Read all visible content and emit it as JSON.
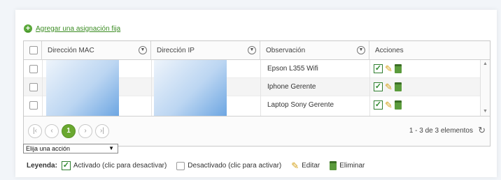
{
  "add_link": {
    "label": "Agregar una asignación fija",
    "icon": "plus-circle-icon"
  },
  "grid": {
    "columns": [
      {
        "key": "select",
        "label": ""
      },
      {
        "key": "mac",
        "label": "Dirección MAC"
      },
      {
        "key": "ip",
        "label": "Dirección IP"
      },
      {
        "key": "obs",
        "label": "Observación"
      },
      {
        "key": "actions",
        "label": "Acciones"
      }
    ],
    "rows": [
      {
        "mac": "",
        "ip": "",
        "obs": "Epson L355 Wifi",
        "actions": [
          "toggle-check-icon",
          "edit-pencil-icon",
          "delete-trash-icon"
        ]
      },
      {
        "mac": "",
        "ip": "",
        "obs": "Iphone Gerente",
        "actions": [
          "toggle-check-icon",
          "edit-pencil-icon",
          "delete-trash-icon"
        ]
      },
      {
        "mac": "",
        "ip": "",
        "obs": "Laptop Sony Gerente",
        "actions": [
          "toggle-check-icon",
          "edit-pencil-icon",
          "delete-trash-icon"
        ]
      }
    ]
  },
  "pager": {
    "first": "|‹",
    "prev": "‹",
    "current_page": "1",
    "next": "›",
    "last": "›|",
    "info": "1 - 3 de 3 elementos"
  },
  "action_select": {
    "selected": "Elija una acción"
  },
  "legend": {
    "label": "Leyenda:",
    "active": "Activado (clic para desactivar)",
    "inactive": "Desactivado (clic para activar)",
    "edit": "Editar",
    "delete": "Eliminar"
  },
  "colors": {
    "accent_green": "#6aa830",
    "link_green": "#3a8c22",
    "pencil": "#d4a21b"
  }
}
